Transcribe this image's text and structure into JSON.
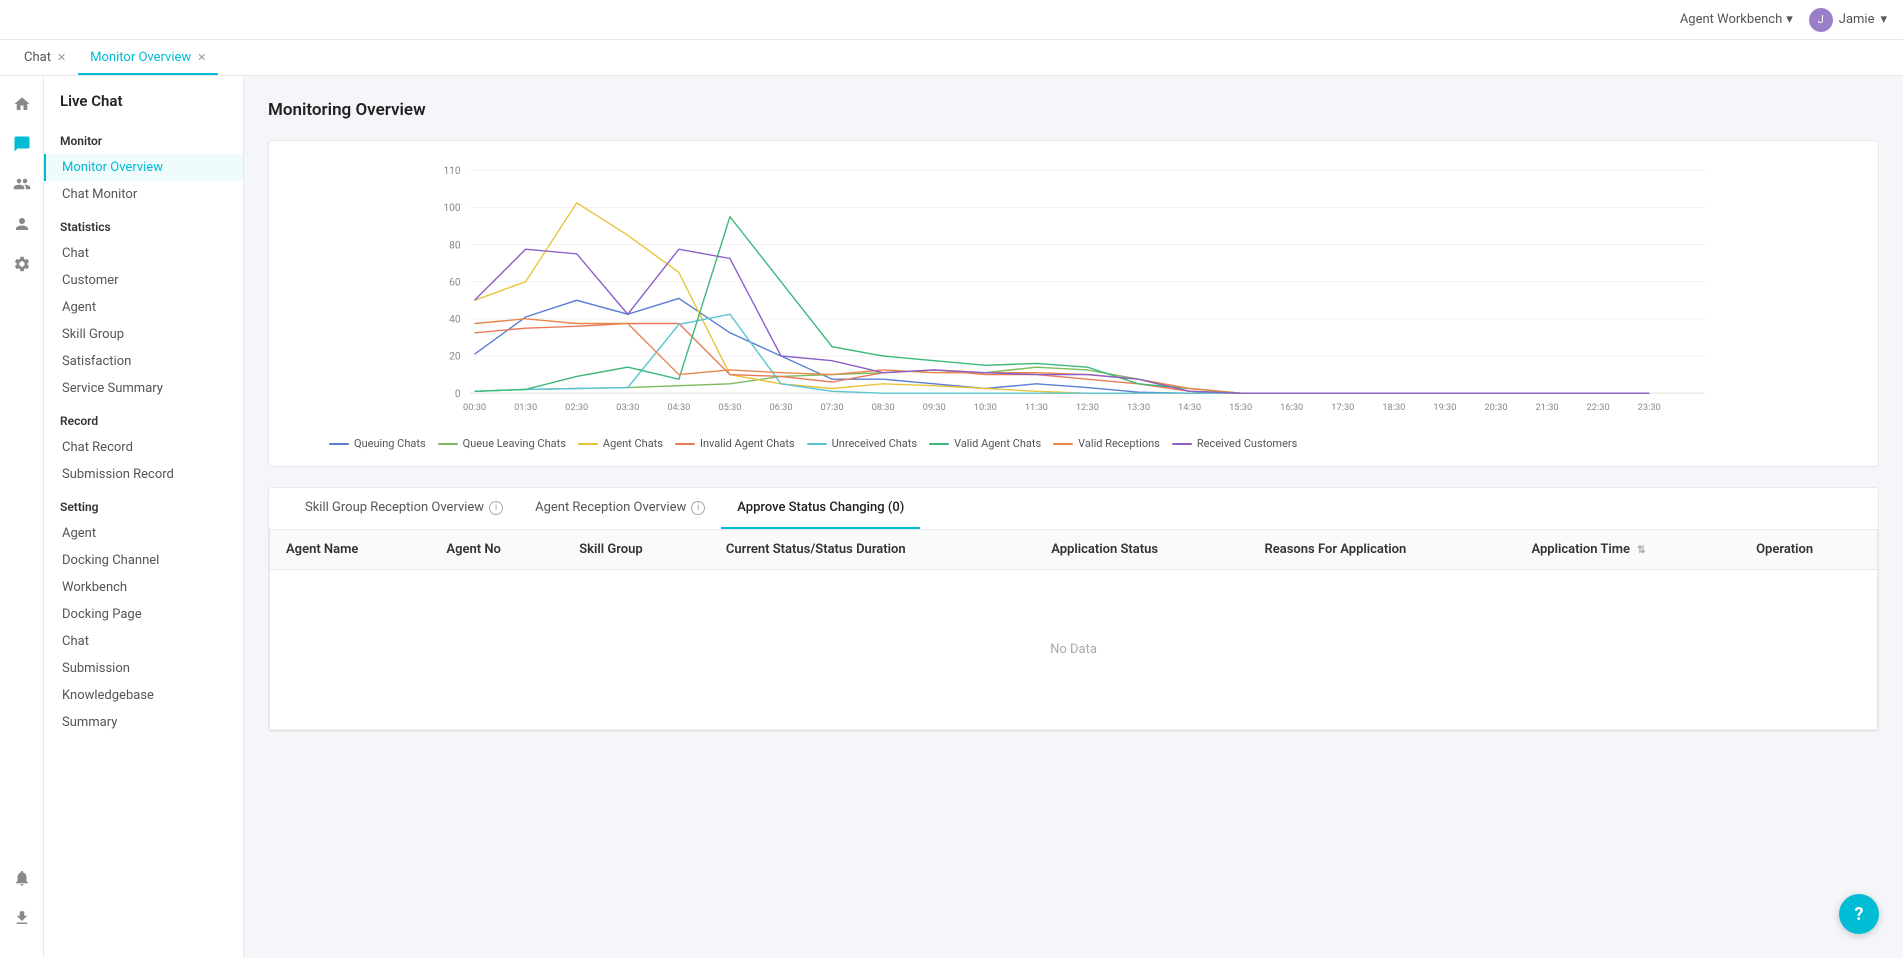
{
  "topbar": {
    "workbench_label": "Agent Workbench",
    "user_name": "Jamie",
    "user_initials": "J",
    "chevron": "▾"
  },
  "tabs": [
    {
      "label": "Chat",
      "active": false,
      "closable": true
    },
    {
      "label": "Monitor Overview",
      "active": true,
      "closable": true
    }
  ],
  "nav": {
    "title": "Live Chat",
    "sections": [
      {
        "title": "Monitor",
        "items": [
          {
            "label": "Monitor Overview",
            "active": true
          },
          {
            "label": "Chat Monitor",
            "active": false
          }
        ]
      },
      {
        "title": "Statistics",
        "items": [
          {
            "label": "Chat",
            "active": false
          },
          {
            "label": "Customer",
            "active": false
          },
          {
            "label": "Agent",
            "active": false
          },
          {
            "label": "Skill Group",
            "active": false
          },
          {
            "label": "Satisfaction",
            "active": false
          },
          {
            "label": "Service Summary",
            "active": false
          }
        ]
      },
      {
        "title": "Record",
        "items": [
          {
            "label": "Chat Record",
            "active": false
          },
          {
            "label": "Submission Record",
            "active": false
          }
        ]
      },
      {
        "title": "Setting",
        "items": [
          {
            "label": "Agent",
            "active": false
          },
          {
            "label": "Docking Channel",
            "active": false
          },
          {
            "label": "Workbench",
            "active": false
          },
          {
            "label": "Docking Page",
            "active": false
          },
          {
            "label": "Chat",
            "active": false
          },
          {
            "label": "Submission",
            "active": false
          },
          {
            "label": "Knowledgebase",
            "active": false
          },
          {
            "label": "Summary",
            "active": false
          }
        ]
      }
    ]
  },
  "page": {
    "title": "Monitoring Overview"
  },
  "section_tabs": [
    {
      "label": "Skill Group Reception Overview",
      "has_info": true,
      "active": false
    },
    {
      "label": "Agent Reception Overview",
      "has_info": true,
      "active": false
    },
    {
      "label": "Approve Status Changing (0)",
      "has_info": false,
      "active": true
    }
  ],
  "table": {
    "columns": [
      "Agent Name",
      "Agent No",
      "Skill Group",
      "Current Status/Status Duration",
      "Application Status",
      "Reasons For Application",
      "Application Time",
      "Operation"
    ],
    "no_data_text": "No Data"
  },
  "legend": [
    {
      "label": "Queuing Chats",
      "color": "#5b7fd4"
    },
    {
      "label": "Queue Leaving Chats",
      "color": "#7dbb5e"
    },
    {
      "label": "Agent Chats",
      "color": "#e8c43a"
    },
    {
      "label": "Invalid Agent Chats",
      "color": "#e87a5a"
    },
    {
      "label": "Unreceived Chats",
      "color": "#5bc4d4"
    },
    {
      "label": "Valid Agent Chats",
      "color": "#3db87a"
    },
    {
      "label": "Valid Receptions",
      "color": "#e8874a"
    },
    {
      "label": "Received Customers",
      "color": "#8b5fc8"
    }
  ],
  "chart": {
    "x_labels": [
      "00:30",
      "01:30",
      "02:30",
      "03:30",
      "04:30",
      "05:30",
      "06:30",
      "07:30",
      "08:30",
      "09:30",
      "10:30",
      "11:30",
      "12:30",
      "13:30",
      "14:30",
      "15:30",
      "16:30",
      "17:30",
      "18:30",
      "19:30",
      "20:30",
      "21:30",
      "22:30",
      "23:30"
    ],
    "y_labels": [
      "0",
      "20",
      "40",
      "60",
      "80",
      "100",
      "110"
    ]
  },
  "help_label": "?"
}
